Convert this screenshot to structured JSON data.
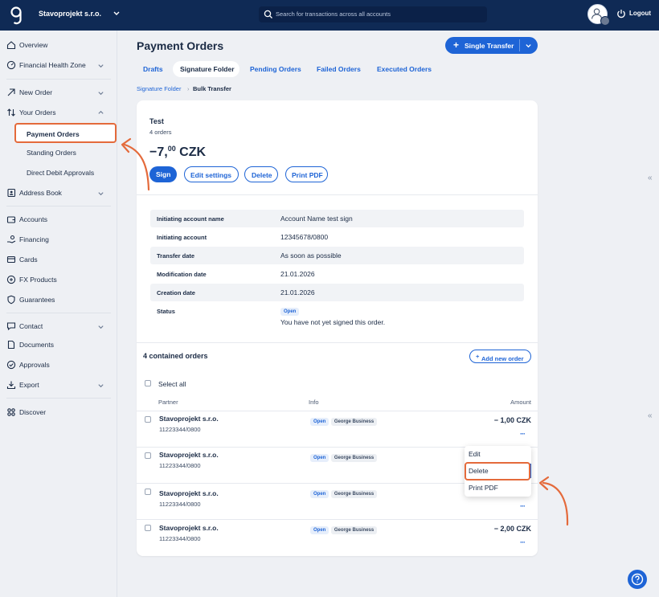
{
  "topbar": {
    "company": "Stavoprojekt s.r.o.",
    "search_placeholder": "Search for transactions across all accounts",
    "logout": "Logout"
  },
  "sidebar": {
    "overview": "Overview",
    "financial_health": "Financial Health Zone",
    "new_order": "New Order",
    "your_orders": "Your Orders",
    "payment_orders": "Payment Orders",
    "standing_orders": "Standing Orders",
    "direct_debit": "Direct Debit Approvals",
    "address_book": "Address Book",
    "accounts": "Accounts",
    "financing": "Financing",
    "cards": "Cards",
    "fx_products": "FX Products",
    "guarantees": "Guarantees",
    "contact": "Contact",
    "documents": "Documents",
    "approvals": "Approvals",
    "export": "Export",
    "discover": "Discover"
  },
  "header": {
    "title": "Payment Orders",
    "single_transfer": "Single Transfer",
    "tabs": [
      "Drafts",
      "Signature Folder",
      "Pending Orders",
      "Failed Orders",
      "Executed Orders"
    ],
    "active_tab": "Signature Folder"
  },
  "breadcrumb": {
    "parent": "Signature Folder",
    "current": "Bulk Transfer"
  },
  "order": {
    "name": "Test",
    "count": "4 orders",
    "amount_int": "−7,",
    "amount_dec": "00",
    "currency": "CZK",
    "buttons": {
      "sign": "Sign",
      "edit": "Edit settings",
      "delete": "Delete",
      "print": "Print PDF"
    },
    "details": [
      {
        "label": "Initiating account name",
        "value": "Account Name test sign"
      },
      {
        "label": "Initiating account",
        "value": "12345678/0800"
      },
      {
        "label": "Transfer date",
        "value": "As soon as possible"
      },
      {
        "label": "Modification date",
        "value": "21.01.2026"
      },
      {
        "label": "Creation date",
        "value": "21.01.2026"
      },
      {
        "label": "Status",
        "badge": "Open",
        "value": "You have not yet signed this order."
      }
    ]
  },
  "contained": {
    "title": "4 contained orders",
    "add_new": "Add new order",
    "select_all": "Select all",
    "columns": {
      "partner": "Partner",
      "info": "Info",
      "amount": "Amount"
    },
    "rows": [
      {
        "partner": "Stavoprojekt s.r.o.",
        "account": "11223344/0800",
        "status": "Open",
        "channel": "George Business",
        "amount": "− 1,00 CZK"
      },
      {
        "partner": "Stavoprojekt s.r.o.",
        "account": "11223344/0800",
        "status": "Open",
        "channel": "George Business",
        "amount": ""
      },
      {
        "partner": "Stavoprojekt s.r.o.",
        "account": "11223344/0800",
        "status": "Open",
        "channel": "George Business",
        "amount": ""
      },
      {
        "partner": "Stavoprojekt s.r.o.",
        "account": "11223344/0800",
        "status": "Open",
        "channel": "George Business",
        "amount": "− 2,00 CZK"
      }
    ],
    "more": "···"
  },
  "row_menu": {
    "items": [
      "Edit",
      "Delete",
      "Print PDF"
    ],
    "highlighted": "Delete"
  },
  "collapse_glyph": "«",
  "colors": {
    "navy": "#0f2a55",
    "primary": "#1e64d6",
    "highlight": "#e46a3b",
    "background": "#eef0f4"
  }
}
